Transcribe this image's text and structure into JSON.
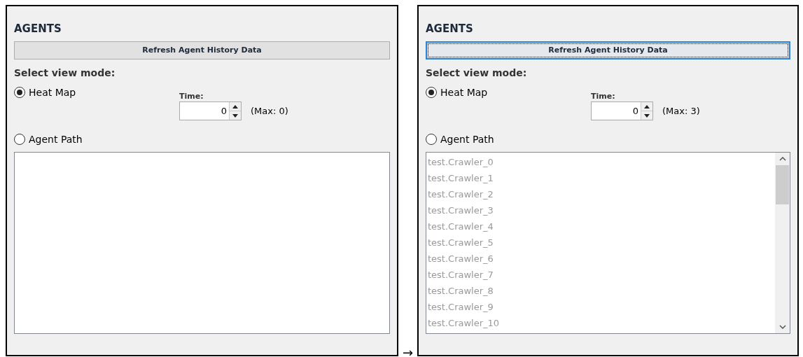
{
  "panels": [
    {
      "title": "AGENTS",
      "refresh_button": {
        "label": "Refresh Agent History Data",
        "focused": false
      },
      "view_mode_label": "Select view mode:",
      "modes": [
        {
          "label": "Heat Map",
          "selected": true
        },
        {
          "label": "Agent Path",
          "selected": false
        }
      ],
      "time": {
        "label": "Time:",
        "value": "0",
        "max_text": "(Max: 0)"
      }
    },
    {
      "title": "AGENTS",
      "refresh_button": {
        "label": "Refresh Agent History Data",
        "focused": true
      },
      "view_mode_label": "Select view mode:",
      "modes": [
        {
          "label": "Heat Map",
          "selected": true
        },
        {
          "label": "Agent Path",
          "selected": false
        }
      ],
      "time": {
        "label": "Time:",
        "value": "0",
        "max_text": "(Max: 3)"
      },
      "agent_list": {
        "disabled": true,
        "items": [
          "test.Crawler_0",
          "test.Crawler_1",
          "test.Crawler_2",
          "test.Crawler_3",
          "test.Crawler_4",
          "test.Crawler_5",
          "test.Crawler_6",
          "test.Crawler_7",
          "test.Crawler_8",
          "test.Crawler_9",
          "test.Crawler_10"
        ]
      }
    }
  ],
  "arrow": "→"
}
